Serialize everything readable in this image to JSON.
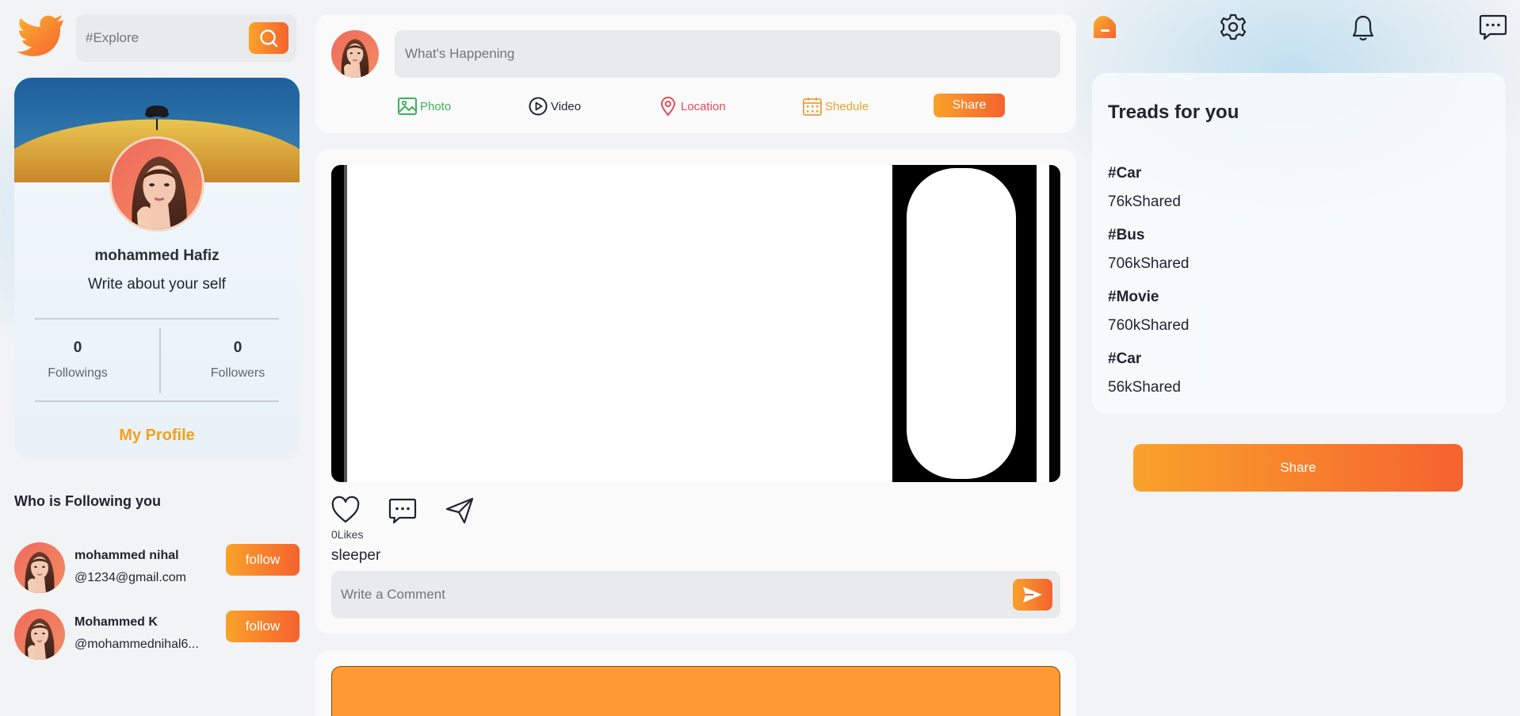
{
  "search": {
    "placeholder": "#Explore"
  },
  "profile": {
    "name": "mohammed Hafiz",
    "bio": "Write about your self",
    "followings_count": "0",
    "followings_label": "Followings",
    "followers_count": "0",
    "followers_label": "Followers",
    "my_profile_link": "My Profile"
  },
  "who_following": {
    "heading": "Who is Following you",
    "users": [
      {
        "name": "mohammed nihal",
        "handle": "@1234@gmail.com",
        "button": "follow"
      },
      {
        "name": "Mohammed K",
        "handle": "@mohammednihal6...",
        "button": "follow"
      }
    ]
  },
  "compose": {
    "placeholder": "What's Happening",
    "actions": {
      "photo": "Photo",
      "video": "Video",
      "location": "Location",
      "schedule": "Shedule"
    },
    "share_label": "Share"
  },
  "post": {
    "likes": "0Likes",
    "caption": "sleeper",
    "comment_placeholder": "Write a Comment"
  },
  "trends": {
    "title": "Treads for you",
    "items": [
      {
        "tag": "#Car",
        "count": "76kShared"
      },
      {
        "tag": "#Bus",
        "count": "706kShared"
      },
      {
        "tag": "#Movie",
        "count": "760kShared"
      },
      {
        "tag": "#Car",
        "count": "56kShared"
      }
    ]
  },
  "share_button": "Share",
  "colors": {
    "accent_orange": "#f5622f",
    "accent_gold": "#f9a22a",
    "photo_green": "#3fae5b",
    "location_red": "#e84b58",
    "schedule_gold": "#e8a23a"
  }
}
